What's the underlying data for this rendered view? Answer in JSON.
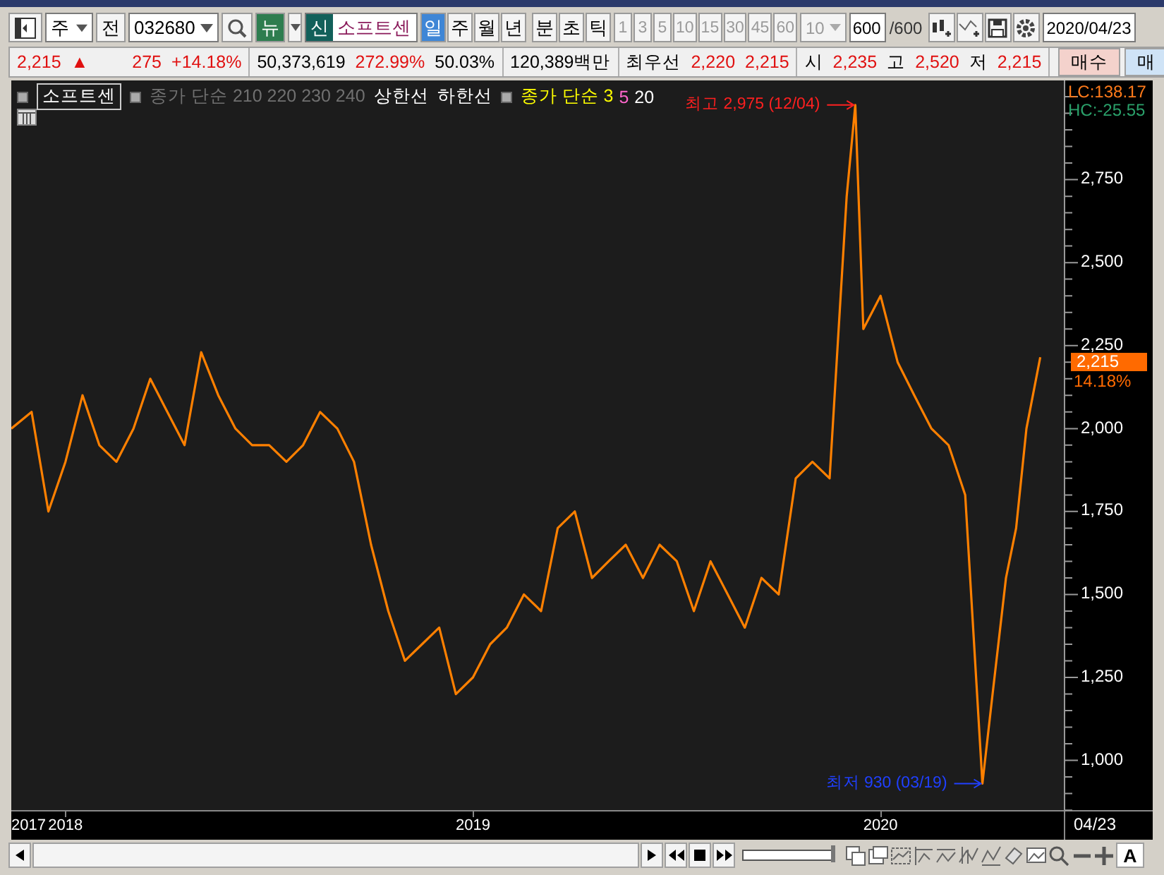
{
  "toolbar": {
    "market_select": {
      "value": "주"
    },
    "all_button": "전",
    "code_field": {
      "value": "032680"
    },
    "news_button": "뉴",
    "credit_badge": "신",
    "name_field": {
      "value": "소프트센"
    },
    "period_tabs": [
      {
        "label": "일",
        "selected": true
      },
      {
        "label": "주",
        "selected": false
      },
      {
        "label": "월",
        "selected": false
      },
      {
        "label": "년",
        "selected": false
      },
      {
        "label": "분",
        "selected": false
      },
      {
        "label": "초",
        "selected": false
      },
      {
        "label": "틱",
        "selected": false
      }
    ],
    "interval_buttons": [
      {
        "label": "1",
        "disabled": true
      },
      {
        "label": "3",
        "disabled": true
      },
      {
        "label": "5",
        "disabled": true
      },
      {
        "label": "10",
        "disabled": true
      },
      {
        "label": "15",
        "disabled": true
      },
      {
        "label": "30",
        "disabled": true
      },
      {
        "label": "45",
        "disabled": true
      },
      {
        "label": "60",
        "disabled": true
      }
    ],
    "count_select": {
      "value": "10",
      "disabled": true
    },
    "count_field": {
      "value": "600"
    },
    "count_total": "/600",
    "date_field": {
      "value": "2020/04/23"
    }
  },
  "quote_bar": {
    "groups": [
      {
        "items": [
          {
            "text": "2,215",
            "kind": "up"
          },
          {
            "text": "▲",
            "kind": "up"
          },
          {
            "text": "275",
            "kind": "up"
          },
          {
            "text": "+14.18%",
            "kind": "up"
          }
        ]
      },
      {
        "items": [
          {
            "text": "50,373,619",
            "kind": "plain"
          },
          {
            "text": "272.99%",
            "kind": "up"
          },
          {
            "text": "50.03%",
            "kind": "plain"
          }
        ]
      },
      {
        "items": [
          {
            "text": "120,389백만",
            "kind": "plain"
          }
        ]
      },
      {
        "items": [
          {
            "text": "최우선",
            "kind": "label"
          },
          {
            "text": "2,220",
            "kind": "up"
          },
          {
            "text": "2,215",
            "kind": "up"
          }
        ]
      },
      {
        "items": [
          {
            "text": "시",
            "kind": "label"
          },
          {
            "text": "2,235",
            "kind": "up"
          },
          {
            "text": "고",
            "kind": "label"
          },
          {
            "text": "2,520",
            "kind": "up"
          },
          {
            "text": "저",
            "kind": "label"
          },
          {
            "text": "2,215",
            "kind": "up"
          }
        ]
      }
    ],
    "buy_button": "매수",
    "sell_button": "매"
  },
  "chart": {
    "legend_groups": [
      {
        "items": [
          {
            "text": "종가 단순 210  220  230  240",
            "kind": "muted"
          },
          {
            "text": "상한선",
            "kind": "plain"
          },
          {
            "text": "하한선",
            "kind": "plain"
          }
        ]
      },
      {
        "items": [
          {
            "text": "종가 단순 3",
            "kind": "series",
            "color": "#ffff00"
          },
          {
            "text": "5",
            "kind": "series",
            "color": "#ff66cc"
          },
          {
            "text": "20",
            "kind": "series",
            "color": "#ffffff"
          }
        ]
      }
    ],
    "lc": "LC:138.17",
    "hc": "HC:-25.55",
    "price_tag": "2,215",
    "change_tag": "14.18%",
    "x_start_label": "2017",
    "x_end_label": "04/23",
    "chart_data": {
      "type": "line",
      "x": [
        2017.867,
        2017.917,
        2017.958,
        2018,
        2018.042,
        2018.083,
        2018.125,
        2018.167,
        2018.208,
        2018.25,
        2018.292,
        2018.333,
        2018.375,
        2018.417,
        2018.458,
        2018.5,
        2018.542,
        2018.583,
        2018.625,
        2018.667,
        2018.708,
        2018.75,
        2018.792,
        2018.833,
        2018.875,
        2018.917,
        2018.958,
        2019,
        2019.042,
        2019.083,
        2019.125,
        2019.167,
        2019.208,
        2019.25,
        2019.292,
        2019.333,
        2019.375,
        2019.417,
        2019.458,
        2019.5,
        2019.542,
        2019.583,
        2019.625,
        2019.667,
        2019.708,
        2019.75,
        2019.792,
        2019.833,
        2019.875,
        2019.917,
        2019.938,
        2019.958,
        2020,
        2020.042,
        2020.083,
        2020.125,
        2020.167,
        2020.208,
        2020.25,
        2020.275,
        2020.308,
        2020.333,
        2020.358,
        2020.392
      ],
      "series": [
        {
          "name": "소프트센",
          "color": "#ff8000",
          "values": [
            2000,
            2050,
            1750,
            1900,
            2100,
            1950,
            1900,
            2000,
            2150,
            2050,
            1950,
            2230,
            2100,
            2000,
            1950,
            1950,
            1900,
            1950,
            2050,
            2000,
            1900,
            1650,
            1450,
            1300,
            1350,
            1400,
            1200,
            1250,
            1350,
            1400,
            1500,
            1450,
            1700,
            1750,
            1550,
            1600,
            1650,
            1550,
            1650,
            1600,
            1450,
            1600,
            1500,
            1400,
            1550,
            1500,
            1850,
            1900,
            1850,
            2700,
            2975,
            2300,
            2400,
            2200,
            2100,
            2000,
            1950,
            1800,
            930,
            1200,
            1550,
            1700,
            2000,
            2215
          ]
        }
      ],
      "xlim": [
        2017.867,
        2020.668
      ],
      "ylim": [
        846,
        3049
      ],
      "xticks": [
        2018,
        2019,
        2020
      ],
      "yticks": [
        {
          "value": 1000,
          "label": "1,000"
        },
        {
          "value": 1250,
          "label": "1,250"
        },
        {
          "value": 1500,
          "label": "1,500"
        },
        {
          "value": 1750,
          "label": "1,750"
        },
        {
          "value": 2000,
          "label": "2,000"
        },
        {
          "value": 2250,
          "label": "2,250"
        },
        {
          "value": 2500,
          "label": "2,500"
        },
        {
          "value": 2750,
          "label": "2,750"
        }
      ],
      "annotations": [
        "최고 2,975 (12/04)",
        "최저 930 (03/19)"
      ]
    }
  },
  "bottom_bar": {
    "zoom_slider": {
      "level": 1
    },
    "auto_button": "A"
  }
}
